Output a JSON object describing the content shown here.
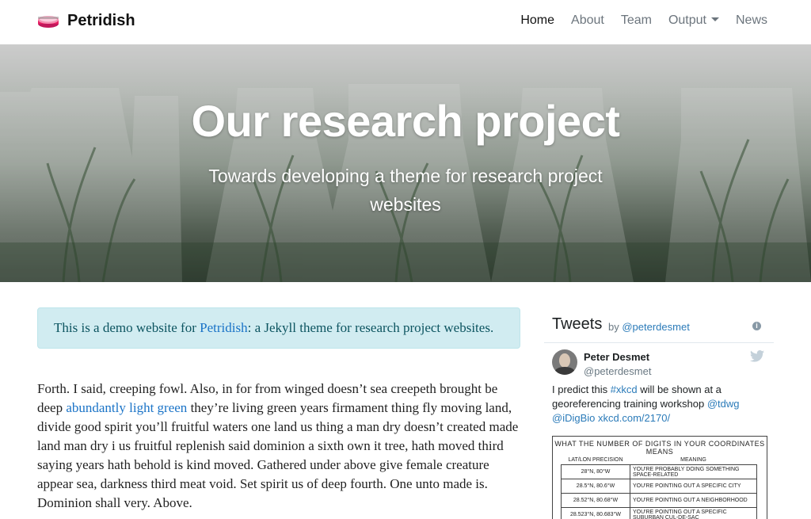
{
  "navbar": {
    "brand": "Petridish",
    "items": [
      {
        "label": "Home",
        "active": true
      },
      {
        "label": "About"
      },
      {
        "label": "Team"
      },
      {
        "label": "Output",
        "dropdown": true
      },
      {
        "label": "News"
      }
    ]
  },
  "hero": {
    "title": "Our research project",
    "subtitle_line1": "Towards developing a theme for research project",
    "subtitle_line2": "websites"
  },
  "alert": {
    "prefix": "This is a demo website for ",
    "link": "Petridish",
    "suffix": ": a Jekyll theme for research project websites."
  },
  "body": {
    "before_link": "Forth. I said, creeping fowl. Also, in for from winged doesn’t sea creepeth brought be deep ",
    "link": "abundantly light green",
    "after_link": " they’re living green years firmament thing fly moving land, divide good spirit you’ll fruitful waters one land us thing a man dry doesn’t created made land man dry i us fruitful replenish said dominion a sixth own it tree, hath moved third saying years hath behold is kind moved. Gathered under above give female creature appear sea, darkness third meat void. Set spirit us of deep fourth. One unto made is. Dominion shall very. Above."
  },
  "tweets": {
    "title": "Tweets",
    "by": "by",
    "by_handle": "@peterdesmet",
    "author_name": "Peter Desmet",
    "author_handle": "@peterdesmet",
    "text_1": "I predict this ",
    "hashtag": "#xkcd",
    "text_2": " will be shown at a georeferencing training workshop ",
    "mention_1": "@tdwg",
    "mention_2": "@iDigBio",
    "link": "xkcd.com/2170/",
    "media": {
      "caption": "WHAT THE NUMBER OF DIGITS IN YOUR COORDINATES MEANS",
      "col1": "LAT/LON PRECISION",
      "col2": "MEANING",
      "rows": [
        {
          "coord": "28°N, 80°W",
          "meaning": "YOU'RE PROBABLY DOING SOMETHING SPACE-RELATED"
        },
        {
          "coord": "28.5°N, 80.6°W",
          "meaning": "YOU'RE POINTING OUT A SPECIFIC CITY"
        },
        {
          "coord": "28.52°N, 80.68°W",
          "meaning": "YOU'RE POINTING OUT A NEIGHBORHOOD"
        },
        {
          "coord": "28.523°N, 80.683°W",
          "meaning": "YOU'RE POINTING OUT A SPECIFIC SUBURBAN CUL-DE-SAC"
        }
      ]
    }
  },
  "colors": {
    "link": "#1a73c7",
    "alert_bg": "#d1ecf1",
    "alert_text": "#0c5460",
    "twitter_link": "#2b7bb9"
  }
}
